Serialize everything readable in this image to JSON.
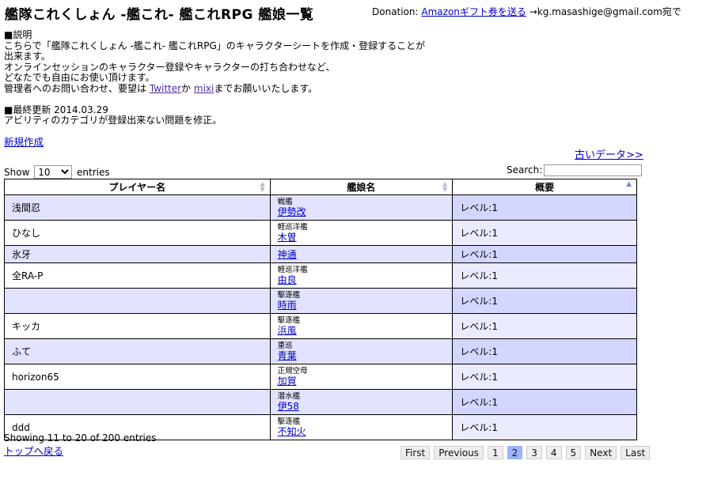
{
  "header": {
    "title": "艦隊これくしょん -艦これ- 艦これRPG 艦娘一覧",
    "donation_prefix": "Donation: ",
    "donation_link": "Amazonギフト券を送る",
    "donation_suffix": " →kg.masashige@gmail.com宛で"
  },
  "info": {
    "heading1": "■説明",
    "desc1": "こちらで「艦隊これくしょん -艦これ- 艦これRPG」のキャラクターシートを作成・登録することが",
    "desc2": "出来ます。",
    "desc3": "オンラインセッションのキャラクター登録やキャラクターの打ち合わせなど、",
    "desc4": "どなたでも自由にお使い頂けます。",
    "desc5_pre": "管理者へのお問い合わせ、要望は ",
    "twitter": "Twitter",
    "desc5_mid": "か ",
    "mixi": "mixi",
    "desc5_post": "までお願いいたします。",
    "heading2": "■最終更新 2014.03.29",
    "update_note": "アビリティのカテゴリが登録出来ない問題を修正。"
  },
  "links": {
    "new": "新規作成",
    "old_data": "古いデータ>>",
    "back_top": "トップへ戻る"
  },
  "controls": {
    "show_label": "Show",
    "show_value": "10",
    "entries_label": "entries",
    "search_label": "Search:"
  },
  "table": {
    "columns": [
      "プレイヤー名",
      "艦娘名",
      "概要"
    ],
    "rows": [
      {
        "player": "浅間忍",
        "type": "戦艦",
        "ship": "伊勢改",
        "summary": "レベル:1"
      },
      {
        "player": "ひなし",
        "type": "軽巡洋艦",
        "ship": "木曽",
        "summary": "レベル:1"
      },
      {
        "player": "氷牙",
        "type": "",
        "ship": "神通",
        "summary": "レベル:1"
      },
      {
        "player": "全RA-P",
        "type": "軽巡洋艦",
        "ship": "由良",
        "summary": "レベル:1"
      },
      {
        "player": "",
        "type": "駆逐艦",
        "ship": "時雨",
        "summary": "レベル:1"
      },
      {
        "player": "キッカ",
        "type": "駆逐艦",
        "ship": "浜風",
        "summary": "レベル:1"
      },
      {
        "player": "ふて",
        "type": "重巡",
        "ship": "青葉",
        "summary": "レベル:1"
      },
      {
        "player": "horizon65",
        "type": "正規空母",
        "ship": "加賀",
        "summary": "レベル:1"
      },
      {
        "player": "",
        "type": "潜水艦",
        "ship": "伊58",
        "summary": "レベル:1"
      },
      {
        "player": "ddd",
        "type": "駆逐艦",
        "ship": "不知火",
        "summary": "レベル:1"
      }
    ]
  },
  "footer": {
    "showing": "Showing 11 to 20 of 200 entries"
  },
  "pagination": {
    "first": "First",
    "previous": "Previous",
    "pages": [
      "1",
      "2",
      "3",
      "4",
      "5"
    ],
    "current": "2",
    "next": "Next",
    "last": "Last"
  },
  "colors": {
    "link": "#0000cc",
    "row_odd": "#e2e4ff",
    "row_odd_sorted": "#d3d6ff",
    "row_even_sorted": "#eaebff",
    "current_page": "#99b3ff"
  }
}
